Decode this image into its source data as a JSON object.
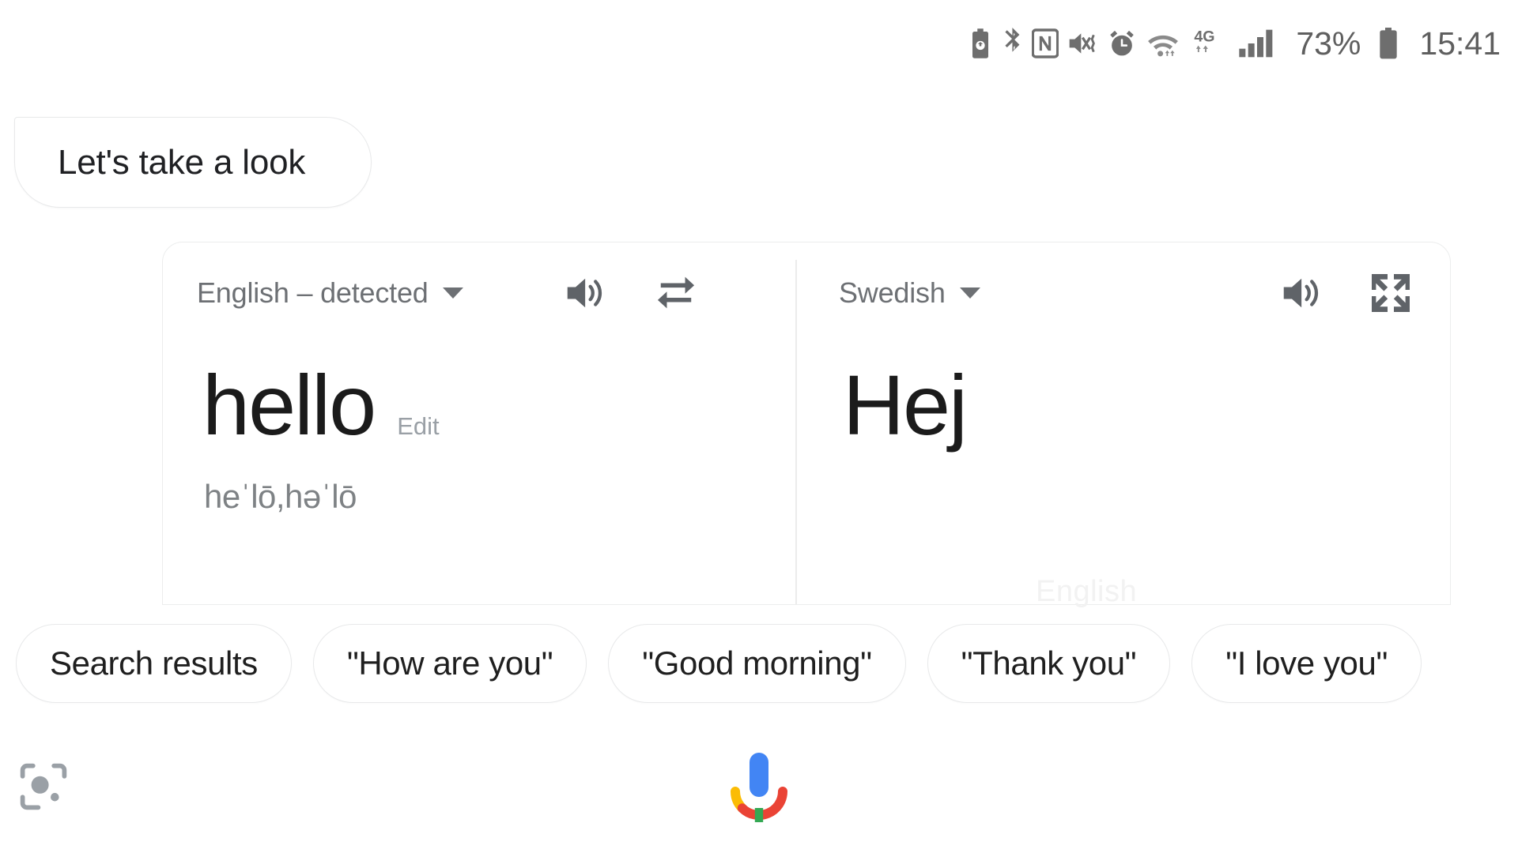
{
  "statusbar": {
    "icons": [
      {
        "name": "battery-saver-icon"
      },
      {
        "name": "bluetooth-icon"
      },
      {
        "name": "nfc-icon"
      },
      {
        "name": "volume-mute-vibrate-icon"
      },
      {
        "name": "alarm-icon"
      },
      {
        "name": "wifi-icon"
      }
    ],
    "network_type": "4G",
    "signal_icon": "cellular-signal-icon",
    "battery_percent": "73%",
    "battery_icon": "battery-full-icon",
    "clock": "15:41"
  },
  "assistant": {
    "bubble_text": "Let's take a look"
  },
  "translate_card": {
    "source": {
      "language_label": "English – detected",
      "caret_icon": "chevron-down-icon",
      "listen_icon": "speaker-icon",
      "text": "hello",
      "edit_label": "Edit",
      "phonetic": "heˈlō,həˈlō"
    },
    "swap_icon": "swap-arrows-icon",
    "target": {
      "language_label": "Swedish",
      "caret_icon": "chevron-down-icon",
      "listen_icon": "speaker-icon",
      "fullscreen_icon": "fullscreen-expand-icon",
      "text": "Hej"
    },
    "clipped_text": "English"
  },
  "suggestions": [
    {
      "label": "Search results"
    },
    {
      "label": "\"How are you\""
    },
    {
      "label": "\"Good morning\""
    },
    {
      "label": "\"Thank you\""
    },
    {
      "label": "\"I love you\""
    }
  ],
  "bottom_bar": {
    "lens_icon": "google-lens-icon",
    "mic_icon": "google-microphone-icon"
  },
  "colors": {
    "mic_blue": "#4285F4",
    "mic_red": "#EA4335",
    "mic_yellow": "#FBBC05",
    "mic_green": "#34A853",
    "text_primary": "#1f1f1f",
    "text_secondary": "#6d7074",
    "border": "#e8e9ea"
  }
}
